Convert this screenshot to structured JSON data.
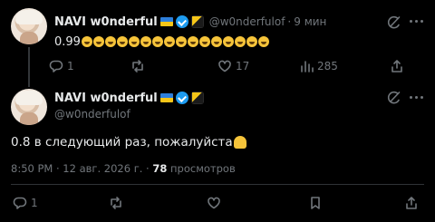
{
  "tweet1": {
    "name": "NAVI w0nderful",
    "handle": "@w0nderfulof",
    "separator": "·",
    "time": "9 мин",
    "text_prefix": "0.99",
    "emoji_count": 16,
    "replies": "1",
    "likes": "17",
    "views": "285"
  },
  "tweet2": {
    "name": "NAVI w0nderful",
    "handle": "@w0nderfulof",
    "text": "0.8 в следующий раз, пожалуйста",
    "timestamp": "8:50 PM · 12 авг. 2026 г. ·",
    "views_count": "78",
    "views_label": "просмотров",
    "replies": "1"
  },
  "icons": {
    "grok": "grok-icon",
    "reply": "reply-icon",
    "retweet": "retweet-icon",
    "like": "heart-icon",
    "views": "bar-chart-icon",
    "bookmark": "bookmark-icon",
    "share": "share-icon"
  },
  "colors": {
    "background": "#000000",
    "text": "#e7e9ea",
    "muted": "#71767b",
    "verified": "#1d9bf0",
    "divider": "#2f3336"
  }
}
